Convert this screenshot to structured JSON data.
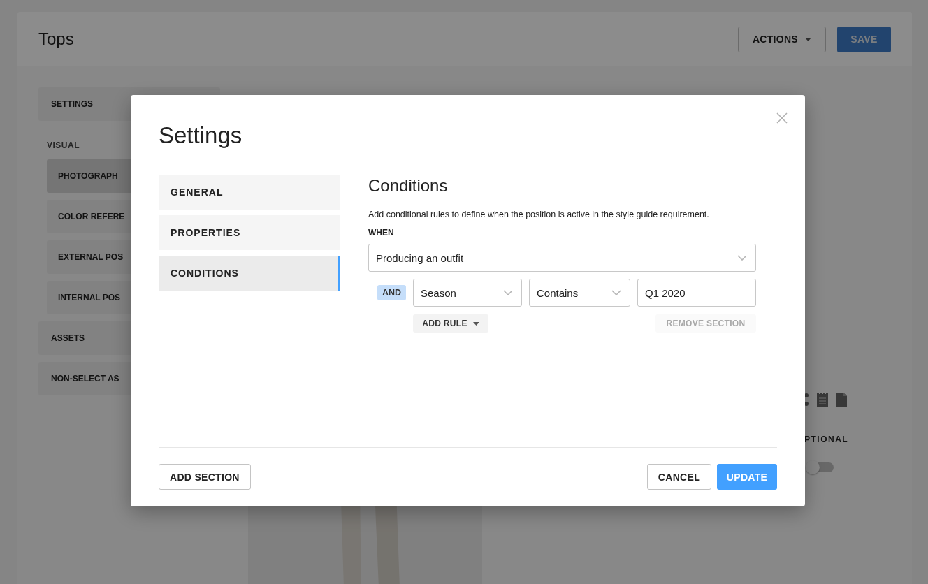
{
  "page": {
    "title": "Tops",
    "actions": [
      {
        "kind": "dropdown",
        "label": "ACTIONS",
        "disabled": false
      },
      {
        "kind": "primary",
        "label": "SAVE",
        "disabled": true
      }
    ]
  },
  "sidebar": [
    {
      "kind": "item",
      "label": "SETTINGS"
    },
    {
      "kind": "group",
      "label": "VISUAL",
      "items": [
        {
          "label": "PHOTOGRAPH",
          "selected": true
        },
        {
          "label": "COLOR REFERE",
          "selected": false
        },
        {
          "label": "EXTERNAL POS",
          "selected": false
        },
        {
          "label": "INTERNAL POS",
          "selected": false
        }
      ]
    },
    {
      "kind": "item",
      "label": "ASSETS"
    },
    {
      "kind": "item",
      "label": "NON-SELECT AS"
    }
  ],
  "main": {
    "optional_label": "PTIONAL",
    "toggle": {
      "on": false
    }
  },
  "modal": {
    "title": "Settings",
    "nav": [
      {
        "label": "GENERAL",
        "selected": false
      },
      {
        "label": "PROPERTIES",
        "selected": false
      },
      {
        "label": "CONDITIONS",
        "selected": true
      }
    ],
    "section": {
      "title": "Conditions",
      "description": "Add conditional rules to define when the position is active in the style guide requirement.",
      "when_label": "WHEN",
      "when_value": "Producing an outfit",
      "rules": [
        {
          "connector": "AND",
          "field": "Season",
          "operator": "Contains",
          "value": "Q1 2020"
        }
      ],
      "add_rule": "ADD RULE",
      "remove_section": {
        "label": "REMOVE SECTION",
        "disabled": true
      }
    },
    "footer": {
      "add_section": "ADD SECTION",
      "cancel": "CANCEL",
      "update": "UPDATE"
    }
  }
}
